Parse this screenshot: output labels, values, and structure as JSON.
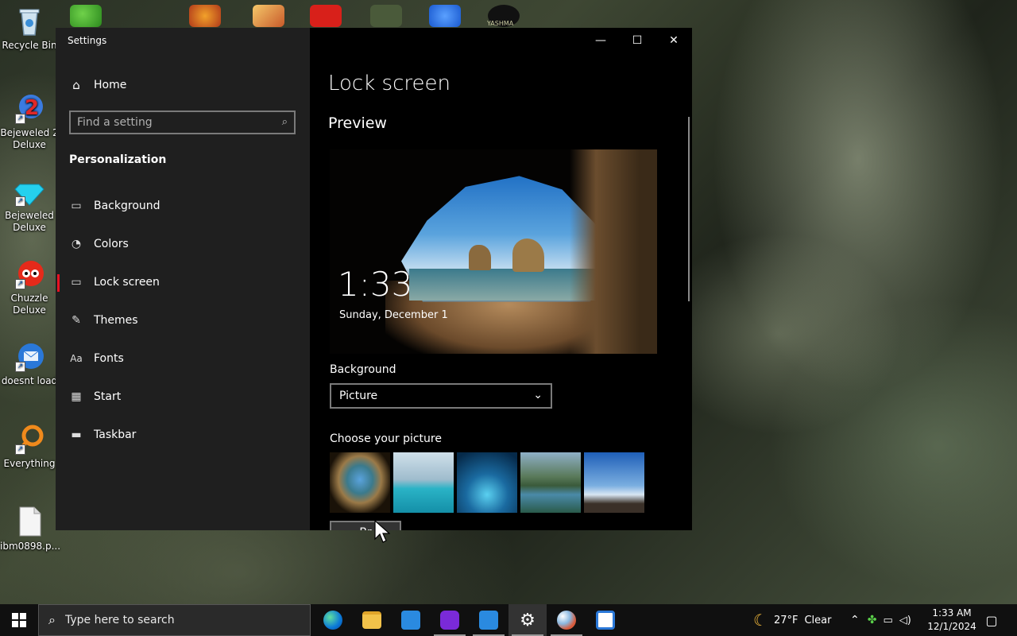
{
  "desktop": {
    "icons": [
      {
        "label": "Recycle Bin"
      },
      {
        "label": "Bejeweled 2 Deluxe"
      },
      {
        "label": "Bejeweled Deluxe"
      },
      {
        "label": "Chuzzle Deluxe"
      },
      {
        "label": "doesnt load"
      },
      {
        "label": "Everything"
      },
      {
        "label": "ibm0898.p..."
      }
    ],
    "top_icon_text": "YASHMA"
  },
  "window": {
    "title": "Settings",
    "controls": {
      "minimize": "—",
      "maximize": "☐",
      "close": "✕"
    }
  },
  "nav": {
    "home_label": "Home",
    "search_placeholder": "Find a setting",
    "section": "Personalization",
    "items": [
      {
        "label": "Background",
        "icon": "image-icon"
      },
      {
        "label": "Colors",
        "icon": "palette-icon"
      },
      {
        "label": "Lock screen",
        "icon": "lock-screen-icon",
        "selected": true
      },
      {
        "label": "Themes",
        "icon": "themes-icon"
      },
      {
        "label": "Fonts",
        "icon": "fonts-icon"
      },
      {
        "label": "Start",
        "icon": "start-icon"
      },
      {
        "label": "Taskbar",
        "icon": "taskbar-icon"
      }
    ]
  },
  "content": {
    "title": "Lock screen",
    "preview_heading": "Preview",
    "preview_time": "1:33",
    "preview_date": "Sunday, December 1",
    "background_label": "Background",
    "background_value": "Picture",
    "choose_label": "Choose your picture",
    "browse_label": "Br"
  },
  "taskbar": {
    "search_placeholder": "Type here to search",
    "weather_temp": "27°F",
    "weather_cond": "Clear",
    "time": "1:33 AM",
    "date": "12/1/2024"
  },
  "colors": {
    "accent_selected": "#e81123",
    "nav_bg": "#1f1f1f",
    "content_bg": "#000000",
    "taskbar_bg": "#101010"
  }
}
